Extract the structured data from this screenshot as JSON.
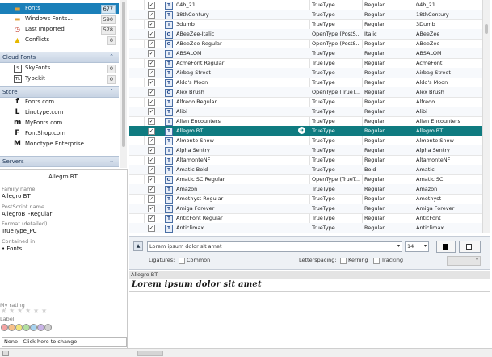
{
  "sidebar": {
    "sources": [
      {
        "icon": "folder-icon",
        "glyph": "▬",
        "color": "#e0a23c",
        "label": "Fonts",
        "count": "677",
        "selected": true
      },
      {
        "icon": "folder-icon",
        "glyph": "▬",
        "color": "#e0a23c",
        "label": "Windows Fonts...",
        "count": "590",
        "selected": false
      },
      {
        "icon": "clock-icon",
        "glyph": "◷",
        "color": "#c0392b",
        "label": "Last Imported",
        "count": "578",
        "selected": false
      },
      {
        "icon": "warning-icon",
        "glyph": "▲",
        "color": "#e6b800",
        "label": "Conflicts",
        "count": "0",
        "selected": false
      }
    ],
    "groups": {
      "cloud": "Cloud Fonts",
      "store": "Store",
      "servers": "Servers"
    },
    "cloud_items": [
      {
        "icon": "skyfonts-icon",
        "glyph": "S",
        "label": "SkyFonts",
        "count": "0"
      },
      {
        "icon": "typekit-icon",
        "glyph": "Tk",
        "label": "Typekit",
        "count": "0"
      }
    ],
    "store_items": [
      {
        "icon": "fontscom-icon",
        "glyph": "f",
        "label": "Fonts.com"
      },
      {
        "icon": "linotype-icon",
        "glyph": "L",
        "label": "Linotype.com"
      },
      {
        "icon": "myfonts-icon",
        "glyph": "m",
        "label": "MyFonts.com"
      },
      {
        "icon": "fontshop-icon",
        "glyph": "F",
        "label": "FontShop.com"
      },
      {
        "icon": "monotype-icon",
        "glyph": "M",
        "label": "Monotype Enterprise"
      }
    ]
  },
  "info": {
    "title": "Allegro BT",
    "family_label": "Family name",
    "family_value": "Allegro BT",
    "postscript_label": "PostScript name",
    "postscript_value": "AllegroBT-Regular",
    "format_label": "Format (detailed)",
    "format_value": "TrueType_PC",
    "contained_label": "Contained in",
    "contained_value": "• Fonts",
    "rating_label": "My rating",
    "label_label": "Label",
    "label_colors": [
      "#f4a3a3",
      "#f7c08a",
      "#f2e57d",
      "#b3e0a0",
      "#a6d3f0",
      "#c8b3e6",
      "#d0d0d0"
    ],
    "note": "None - Click here to change"
  },
  "fonts": [
    {
      "name": "04b_21",
      "type": "TrueType",
      "style": "Regular",
      "family": "04b_21",
      "kind": "T"
    },
    {
      "name": "18thCentury",
      "type": "TrueType",
      "style": "Regular",
      "family": "18thCentury",
      "kind": "T"
    },
    {
      "name": "3dumb",
      "type": "TrueType",
      "style": "Regular",
      "family": "3Dumb",
      "kind": "T"
    },
    {
      "name": "ABeeZee-Italic",
      "type": "OpenType (PostS...",
      "style": "Italic",
      "family": "ABeeZee",
      "kind": "O"
    },
    {
      "name": "ABeeZee-Regular",
      "type": "OpenType (PostS...",
      "style": "Regular",
      "family": "ABeeZee",
      "kind": "O"
    },
    {
      "name": "ABSALOM",
      "type": "TrueType",
      "style": "Regular",
      "family": "ABSALOM",
      "kind": "T"
    },
    {
      "name": "AcmeFont Regular",
      "type": "TrueType",
      "style": "Regular",
      "family": "AcmeFont",
      "kind": "T"
    },
    {
      "name": "Airbag Street",
      "type": "TrueType",
      "style": "Regular",
      "family": "Airbag Street",
      "kind": "T"
    },
    {
      "name": "Aldo's Moon",
      "type": "TrueType",
      "style": "Regular",
      "family": "Aldo's Moon",
      "kind": "T"
    },
    {
      "name": "Alex Brush",
      "type": "OpenType (TrueT...",
      "style": "Regular",
      "family": "Alex Brush",
      "kind": "O"
    },
    {
      "name": "Alfredo Regular",
      "type": "TrueType",
      "style": "Regular",
      "family": "Alfredo",
      "kind": "T"
    },
    {
      "name": "Alibi",
      "type": "TrueType",
      "style": "Regular",
      "family": "Alibi",
      "kind": "T"
    },
    {
      "name": "Alien Encounters",
      "type": "TrueType",
      "style": "Regular",
      "family": "Alien Encounters",
      "kind": "T"
    },
    {
      "name": "Allegro BT",
      "type": "TrueType",
      "style": "Regular",
      "family": "Allegro BT",
      "kind": "T",
      "selected": true
    },
    {
      "name": "Almonte Snow",
      "type": "TrueType",
      "style": "Regular",
      "family": "Almonte Snow",
      "kind": "T"
    },
    {
      "name": "Alpha Sentry",
      "type": "TrueType",
      "style": "Regular",
      "family": "Alpha Sentry",
      "kind": "T"
    },
    {
      "name": "AltamonteNF",
      "type": "TrueType",
      "style": "Regular",
      "family": "AltamonteNF",
      "kind": "T"
    },
    {
      "name": "Amatic Bold",
      "type": "TrueType",
      "style": "Bold",
      "family": "Amatic",
      "kind": "T"
    },
    {
      "name": "Amatic SC Regular",
      "type": "OpenType (TrueT...",
      "style": "Regular",
      "family": "Amatic SC",
      "kind": "O"
    },
    {
      "name": "Amazon",
      "type": "TrueType",
      "style": "Regular",
      "family": "Amazon",
      "kind": "T"
    },
    {
      "name": "Amethyst Regular",
      "type": "TrueType",
      "style": "Regular",
      "family": "Amethyst",
      "kind": "T"
    },
    {
      "name": "Amiga Forever",
      "type": "TrueType",
      "style": "Regular",
      "family": "Amiga Forever",
      "kind": "T"
    },
    {
      "name": "AnticFont Regular",
      "type": "TrueType",
      "style": "Regular",
      "family": "AnticFont",
      "kind": "T"
    },
    {
      "name": "Anticlimax",
      "type": "TrueType",
      "style": "Regular",
      "family": "Anticlimax",
      "kind": "T"
    }
  ],
  "preview_toolbar": {
    "sample_text": "Lorem ipsum dolor sit amet",
    "size": "14",
    "ligatures_label": "Ligatures:",
    "common_label": "Common",
    "letterspacing_label": "Letterspacing:",
    "kerning_label": "Kerning",
    "tracking_label": "Tracking"
  },
  "preview": {
    "font_name": "Allegro BT",
    "sample": "Lorem ipsum dolor sit amet"
  },
  "colors": {
    "selected_source": "#1a7fb9",
    "selected_row": "#0f7b80",
    "group_header": "#c7d3e3"
  }
}
